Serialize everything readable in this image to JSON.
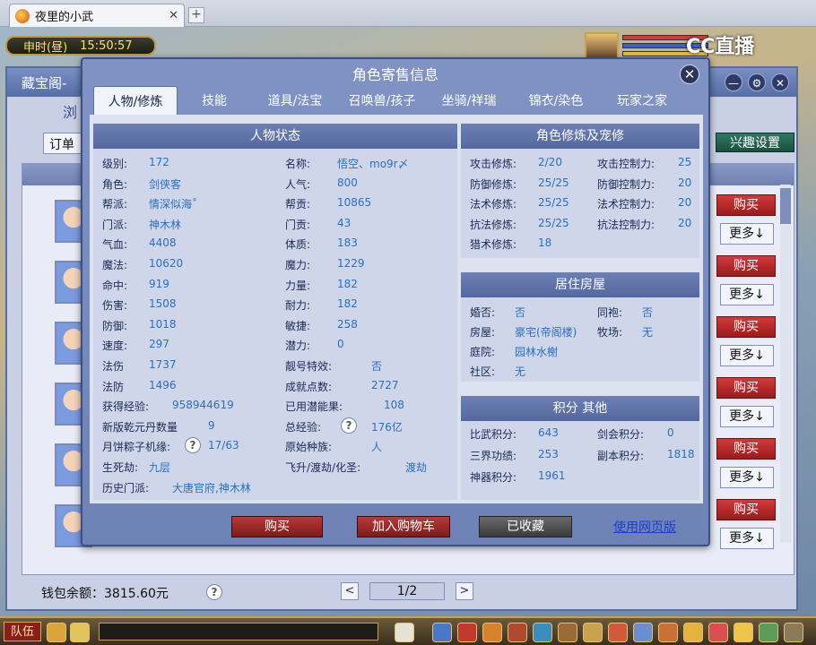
{
  "browser": {
    "tab_title": "夜里的小武",
    "close": "✕",
    "new_tab": "+"
  },
  "game": {
    "clock": "申时(昼)",
    "time": "15:50:57",
    "live_brand": "CC直播",
    "hp_colors": [
      "#d43a3a",
      "#3a5fd4",
      "#e0c043"
    ]
  },
  "bgwin": {
    "title": "藏宝阁-",
    "sub": "浏",
    "order_label": "订单",
    "interest_button": "兴趣设置",
    "rows": [
      {
        "buy": "购买",
        "more": "更多↓"
      },
      {
        "buy": "购买",
        "more": "更多↓"
      },
      {
        "buy": "购买",
        "more": "更多↓"
      },
      {
        "buy": "购买",
        "more": "更多↓"
      },
      {
        "buy": "购买",
        "more": "更多↓"
      },
      {
        "buy": "购买",
        "more": "更多↓"
      }
    ],
    "wallet": "钱包余额：3815.60元",
    "help": "?",
    "page": "1/2",
    "prev": "<",
    "next": ">"
  },
  "modal": {
    "title": "角色寄售信息",
    "close": "✕",
    "tabs": [
      "人物/修炼",
      "技能",
      "道具/法宝",
      "召唤兽/孩子",
      "坐骑/祥瑞",
      "锦衣/染色",
      "玩家之家"
    ],
    "status": {
      "header": "人物状态",
      "left": [
        {
          "k": "级别:",
          "v": "172"
        },
        {
          "k": "角色:",
          "v": "剑侠客"
        },
        {
          "k": "帮派:",
          "v": "情深似海˚"
        },
        {
          "k": "门派:",
          "v": "神木林"
        },
        {
          "k": "气血:",
          "v": "4408"
        },
        {
          "k": "魔法:",
          "v": "10620"
        },
        {
          "k": "命中:",
          "v": "919"
        },
        {
          "k": "伤害:",
          "v": "1508"
        },
        {
          "k": "防御:",
          "v": "1018"
        },
        {
          "k": "速度:",
          "v": "297"
        },
        {
          "k": "法伤",
          "v": "1737"
        },
        {
          "k": "法防",
          "v": "1496"
        },
        {
          "k": "获得经验:",
          "v": "958944619"
        },
        {
          "k": "新版乾元丹数量",
          "v": "9"
        },
        {
          "k": "月饼粽子机缘:",
          "v": "17/63"
        },
        {
          "k": "生死劫:",
          "v": "九层"
        },
        {
          "k": "历史门派:",
          "v": "大唐官府,神木林"
        }
      ],
      "right": [
        {
          "k": "名称:",
          "v": "悟空、mo9r〆"
        },
        {
          "k": "人气:",
          "v": "800"
        },
        {
          "k": "帮贡:",
          "v": "10865"
        },
        {
          "k": "门贡:",
          "v": "43"
        },
        {
          "k": "体质:",
          "v": "183"
        },
        {
          "k": "魔力:",
          "v": "1229"
        },
        {
          "k": "力量:",
          "v": "182"
        },
        {
          "k": "耐力:",
          "v": "182"
        },
        {
          "k": "敏捷:",
          "v": "258"
        },
        {
          "k": "潜力:",
          "v": "0"
        },
        {
          "k": "靓号特效:",
          "v": "否"
        },
        {
          "k": "成就点数:",
          "v": "2727"
        },
        {
          "k": "已用潜能果:",
          "v": "108"
        },
        {
          "k": "总经验:",
          "v": "176亿"
        },
        {
          "k": "原始种族:",
          "v": "人"
        },
        {
          "k": "飞升/渡劫/化圣:",
          "v": "渡劫"
        }
      ]
    },
    "cultivation": {
      "header": "角色修炼及宠修",
      "left": [
        {
          "k": "攻击修炼:",
          "v": "2/20"
        },
        {
          "k": "防御修炼:",
          "v": "25/25"
        },
        {
          "k": "法术修炼:",
          "v": "25/25"
        },
        {
          "k": "抗法修炼:",
          "v": "25/25"
        },
        {
          "k": "猎术修炼:",
          "v": "18"
        }
      ],
      "right": [
        {
          "k": "攻击控制力:",
          "v": "25"
        },
        {
          "k": "防御控制力:",
          "v": "20"
        },
        {
          "k": "法术控制力:",
          "v": "20"
        },
        {
          "k": "抗法控制力:",
          "v": "20"
        }
      ]
    },
    "residence": {
      "header": "居住房屋",
      "left": [
        {
          "k": "婚否:",
          "v": "否"
        },
        {
          "k": "房屋:",
          "v": "豪宅(帝阁楼)"
        },
        {
          "k": "庭院:",
          "v": "园林水榭"
        },
        {
          "k": "社区:",
          "v": "无"
        }
      ],
      "right": [
        {
          "k": "同袍:",
          "v": "否"
        },
        {
          "k": "牧场:",
          "v": "无"
        }
      ]
    },
    "points": {
      "header": "积分 其他",
      "left": [
        {
          "k": "比武积分:",
          "v": "643"
        },
        {
          "k": "三界功绩:",
          "v": "253"
        },
        {
          "k": "神器积分:",
          "v": "1961"
        }
      ],
      "right": [
        {
          "k": "剑会积分:",
          "v": "0"
        },
        {
          "k": "副本积分:",
          "v": "1818"
        }
      ]
    },
    "buttons": {
      "buy": "购买",
      "cart": "加入购物车",
      "favorited": "已收藏",
      "web": "使用网页版"
    }
  },
  "taskbar": {
    "team": "队伍"
  }
}
